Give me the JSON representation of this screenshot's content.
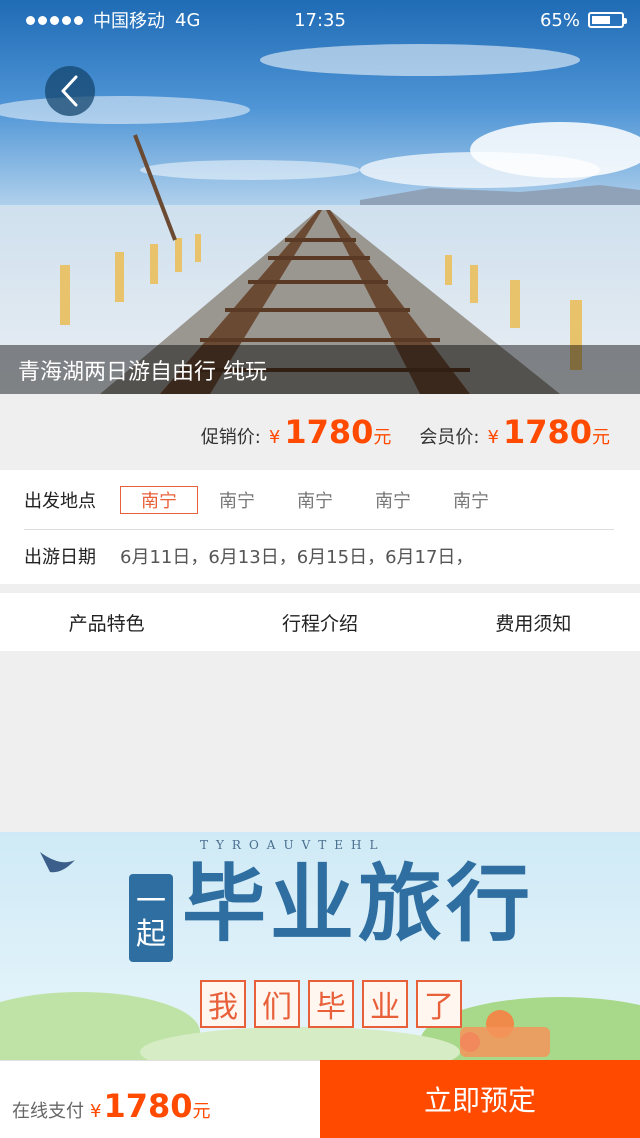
{
  "status_bar": {
    "carrier": "中国移动",
    "network": "4G",
    "time": "17:35",
    "battery": "65%",
    "battery_level": 0.65
  },
  "hero": {
    "back_icon": "chevron-left-icon",
    "title": "青海湖两日游自由行 纯玩"
  },
  "price": {
    "promo_label": "促销价:",
    "promo_currency": "¥",
    "promo_value": "1780",
    "promo_unit": "元",
    "member_label": "会员价:",
    "member_currency": "¥",
    "member_value": "1780",
    "member_unit": "元"
  },
  "departure": {
    "label": "出发地点",
    "cities": [
      "南宁",
      "南宁",
      "南宁",
      "南宁",
      "南宁"
    ],
    "selected_index": 0
  },
  "travel_date": {
    "label": "出游日期",
    "dates": "6月11日，6月13日，6月15日，6月17日，"
  },
  "tabs": [
    "产品特色",
    "行程介绍",
    "费用须知"
  ],
  "banner": {
    "letters": "TYROAUVTEHL",
    "badge": [
      "一",
      "起"
    ],
    "title": "毕业旅行",
    "subtitle": [
      "我",
      "们",
      "毕",
      "业",
      "了"
    ]
  },
  "bottom_bar": {
    "pay_label": "在线支付",
    "currency": "¥",
    "amount": "1780",
    "unit": "元",
    "book_label": "立即预定"
  },
  "colors": {
    "accent": "#ff4a00",
    "city_active": "#e8603a",
    "banner_blue": "#2f6ea0"
  }
}
